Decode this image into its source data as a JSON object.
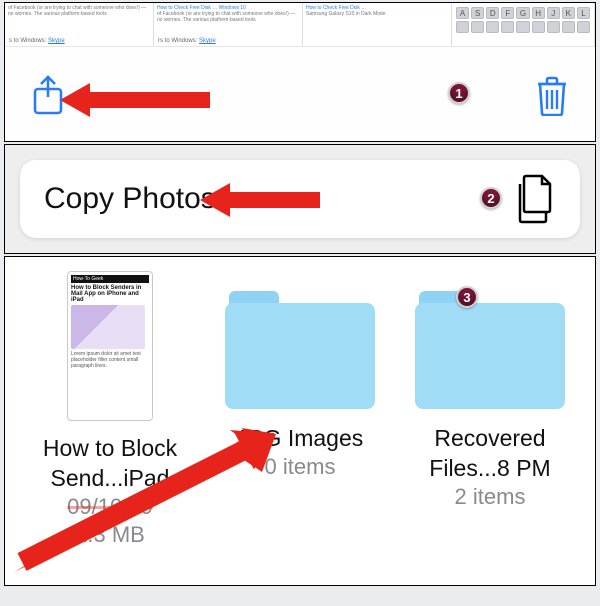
{
  "panel1": {
    "tabs": {
      "left_text": "of Facebook (or are trying to chat with someone who does!) — no worries. The various platform-based tools",
      "left_footer_prefix": "s to Windows: ",
      "left_footer_link": "Skype",
      "mid_doc_title": "How to Check Free Disk … Windows 10",
      "mid_text": "of Facebook (or are trying to chat with someone who does!) — no worries. The various platform-based tools",
      "mid_footer_prefix": "rs to Windows: ",
      "mid_footer_link": "Skype",
      "right_doc_title": "How to Check Free Disk …",
      "right_sub": "Samsung Galaxy S10 in Dark Mode"
    },
    "keys": [
      "A",
      "S",
      "D",
      "F",
      "G",
      "H",
      "J",
      "K",
      "L"
    ]
  },
  "panel2": {
    "copy_label": "Copy Photos"
  },
  "panel3": {
    "items": [
      {
        "kind": "doc",
        "thumb_bar": "How-To Geek",
        "thumb_title": "How to Block Senders in Mail App on iPhone and iPad",
        "name_line1": "How to Block",
        "name_line2": "Send...iPad",
        "meta_line1": "09/10/19",
        "meta_line2": "1.3 MB"
      },
      {
        "kind": "folder",
        "name_line1": "JPG Images",
        "meta_line1": "0 items"
      },
      {
        "kind": "folder",
        "name_line1": "Recovered",
        "name_line2": "Files...8 PM",
        "meta_line1": "2 items"
      }
    ]
  },
  "badges": {
    "b1": "1",
    "b2": "2",
    "b3": "3"
  },
  "colors": {
    "accent": "#2a7cf6",
    "arrow": "#e7241b",
    "badge": "#7a1637",
    "folder": "#a1dcf7"
  }
}
